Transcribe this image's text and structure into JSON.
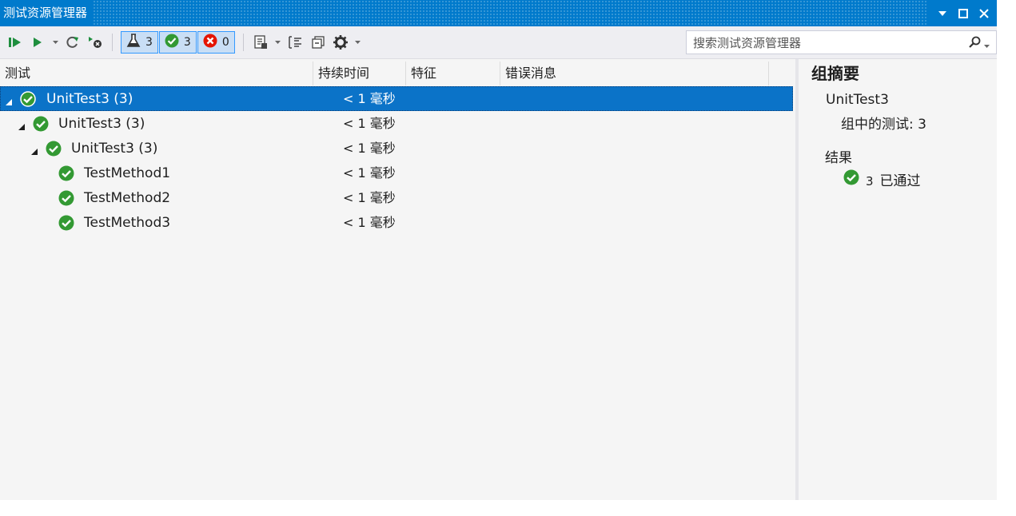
{
  "window": {
    "title": "测试资源管理器"
  },
  "toolbar": {
    "filters": [
      {
        "icon": "flask-icon",
        "count": "3"
      },
      {
        "icon": "passed-icon",
        "count": "3"
      },
      {
        "icon": "failed-icon",
        "count": "0"
      }
    ],
    "search_placeholder": "搜索测试资源管理器"
  },
  "columns": {
    "test": "测试",
    "duration": "持续时间",
    "traits": "特征",
    "error": "错误消息"
  },
  "tree": [
    {
      "name": "UnitTest3 (3)",
      "duration": "< 1 毫秒",
      "level": 0,
      "expanded": true,
      "selected": true
    },
    {
      "name": "UnitTest3  (3)",
      "duration": "< 1 毫秒",
      "level": 1,
      "expanded": true,
      "selected": false
    },
    {
      "name": "UnitTest3  (3)",
      "duration": "< 1 毫秒",
      "level": 2,
      "expanded": true,
      "selected": false
    },
    {
      "name": "TestMethod1",
      "duration": "< 1 毫秒",
      "level": 3,
      "expanded": false,
      "selected": false
    },
    {
      "name": "TestMethod2",
      "duration": "< 1 毫秒",
      "level": 3,
      "expanded": false,
      "selected": false
    },
    {
      "name": "TestMethod3",
      "duration": "< 1 毫秒",
      "level": 3,
      "expanded": false,
      "selected": false
    }
  ],
  "summary": {
    "title": "组摘要",
    "group_name": "UnitTest3",
    "tests_in_group": "组中的测试: 3",
    "results_label": "结果",
    "passed_count": "3",
    "passed_label": "已通过"
  },
  "colors": {
    "accent": "#007acc",
    "selection": "#0b73c8",
    "passed": "#339933",
    "failed": "#e51400"
  }
}
